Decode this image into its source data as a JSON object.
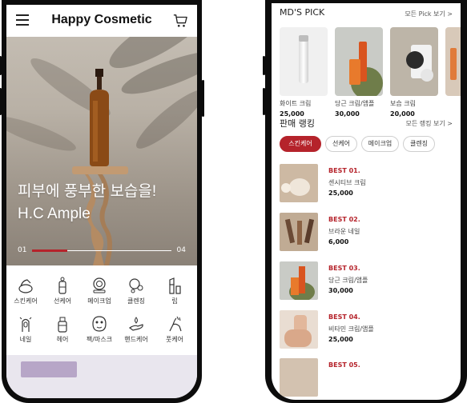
{
  "left": {
    "header": {
      "title": "Happy Cosmetic",
      "menu_icon": "hamburger-menu-icon",
      "cart_icon": "cart-icon"
    },
    "hero": {
      "headline": "피부에 풍부한 보습을!",
      "subline": "H.C Ample",
      "slide_current": "01",
      "slide_total": "04",
      "progress": 0.25
    },
    "categories": [
      {
        "label": "스킨케어",
        "icon": "skincare-icon"
      },
      {
        "label": "선케어",
        "icon": "suncare-icon"
      },
      {
        "label": "메이크업",
        "icon": "makeup-compact-icon"
      },
      {
        "label": "클렌징",
        "icon": "cleansing-icon"
      },
      {
        "label": "립",
        "icon": "lipstick-icon"
      },
      {
        "label": "네일",
        "icon": "nail-icon"
      },
      {
        "label": "헤어",
        "icon": "hair-bottle-icon"
      },
      {
        "label": "팩/마스크",
        "icon": "face-mask-icon"
      },
      {
        "label": "핸드케어",
        "icon": "hand-care-icon"
      },
      {
        "label": "풋케어",
        "icon": "foot-care-icon"
      }
    ]
  },
  "right": {
    "md_pick": {
      "title": "MD'S PICK",
      "view_all": "모든 Pick 보기 >",
      "items": [
        {
          "name": "화이트 크림",
          "price": "25,000"
        },
        {
          "name": "당근 크림/앰플",
          "price": "30,000"
        },
        {
          "name": "보습 크림",
          "price": "20,000"
        },
        {
          "name": "",
          "price": ""
        }
      ]
    },
    "ranking": {
      "title": "판매 랭킹",
      "view_all": "모든 랭킹 보기 >",
      "tabs": [
        "스킨케어",
        "선케어",
        "메이크업",
        "클렌징"
      ],
      "items": [
        {
          "rank": "BEST 01.",
          "name": "센시티브 크림",
          "price": "25,000"
        },
        {
          "rank": "BEST 02.",
          "name": "브라운 네일",
          "price": "6,000"
        },
        {
          "rank": "BEST 03.",
          "name": "당근 크림/앰플",
          "price": "30,000"
        },
        {
          "rank": "BEST 04.",
          "name": "비타민 크림/앰플",
          "price": "25,000"
        },
        {
          "rank": "BEST 05.",
          "name": "",
          "price": ""
        }
      ]
    }
  },
  "colors": {
    "accent": "#b5232b",
    "frame": "#0c0c0c",
    "text": "#222222"
  }
}
